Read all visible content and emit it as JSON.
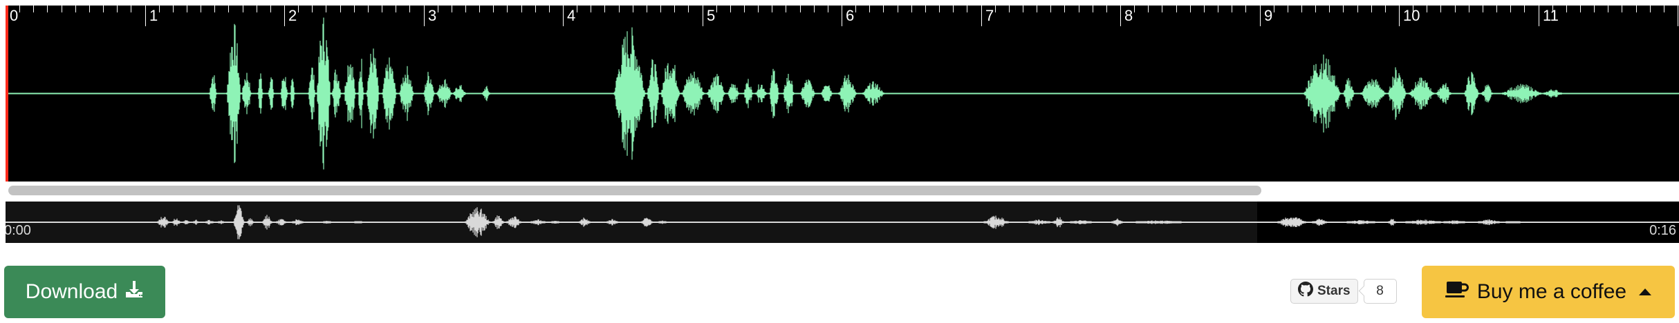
{
  "waveform": {
    "ruler_labels": [
      "0",
      "1",
      "2",
      "3",
      "4",
      "5",
      "6",
      "7",
      "8",
      "9",
      "10",
      "11"
    ],
    "wave_color": "#8ef3b6",
    "cursor_color": "#ff2a1a",
    "background": "#000000"
  },
  "overview": {
    "start_time": "0:00",
    "end_time": "0:16",
    "wave_color": "#d9d9d9"
  },
  "toolbar": {
    "download_label": "Download",
    "download_icon": "download-icon",
    "github_stars_label": "Stars",
    "github_stars_count": "8",
    "github_icon": "github-icon",
    "coffee_label": "Buy me a coffee",
    "coffee_icon": "coffee-cup-icon",
    "download_color": "#3b8a57",
    "coffee_color": "#f6c542"
  }
}
